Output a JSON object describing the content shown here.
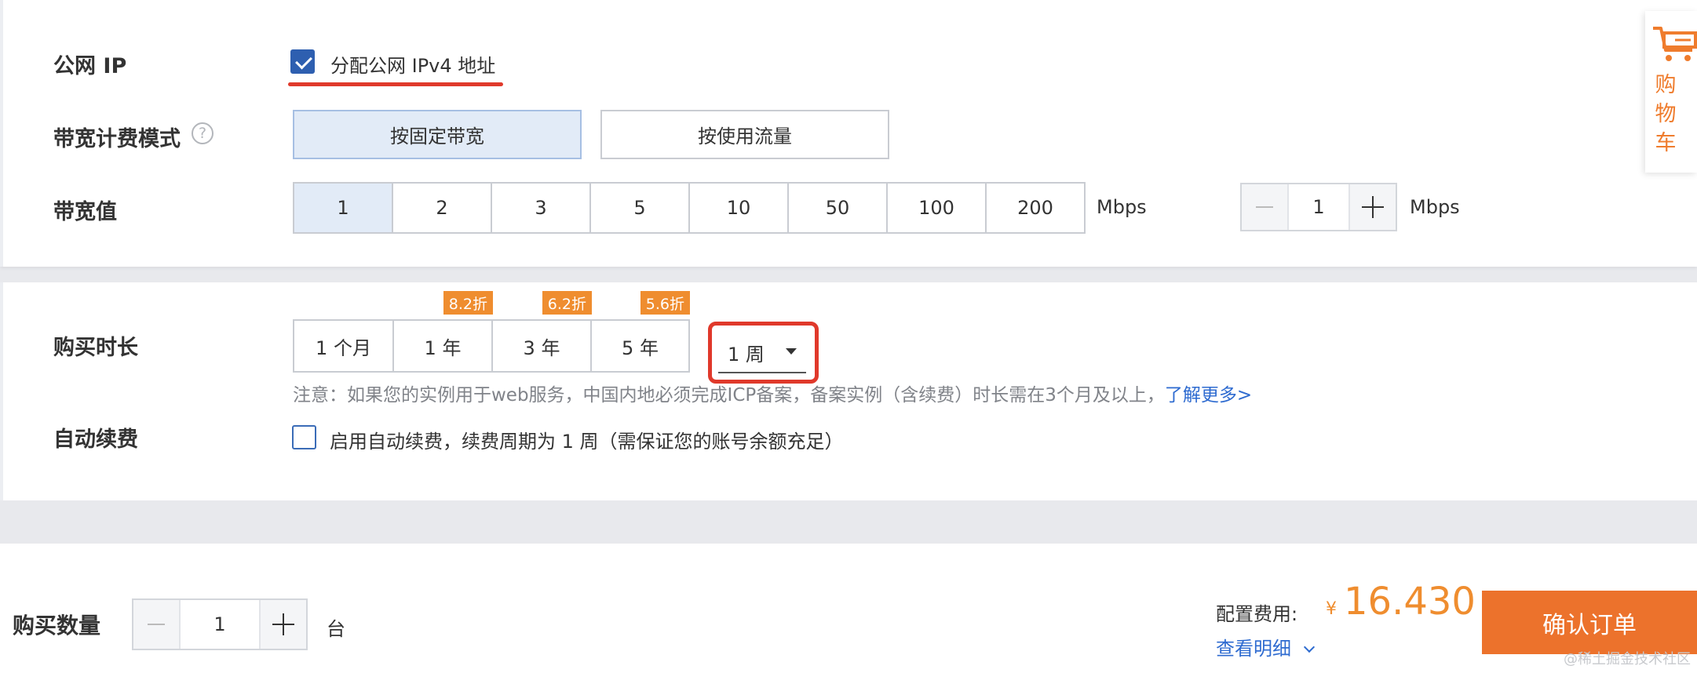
{
  "public_ip": {
    "label": "公网 IP",
    "checkbox_label": "分配公网 IPv4 地址",
    "checked": true
  },
  "billing_mode": {
    "label": "带宽计费模式",
    "help_icon": "question-circle-icon",
    "options": [
      "按固定带宽",
      "按使用流量"
    ],
    "selected": "按固定带宽"
  },
  "bandwidth": {
    "label": "带宽值",
    "options": [
      "1",
      "2",
      "3",
      "5",
      "10",
      "50",
      "100",
      "200"
    ],
    "selected": "1",
    "unit": "Mbps",
    "stepper_value": "1",
    "stepper_unit": "Mbps"
  },
  "duration": {
    "label": "购买时长",
    "options": [
      {
        "label": "1 个月",
        "discount": ""
      },
      {
        "label": "1 年",
        "discount": "8.2折"
      },
      {
        "label": "3 年",
        "discount": "6.2折"
      },
      {
        "label": "5 年",
        "discount": "5.6折"
      }
    ],
    "dropdown_value": "1 周",
    "notice_text": "注意：如果您的实例用于web服务，中国内地必须完成ICP备案，备案实例（含续费）时长需在3个月及以上，",
    "notice_link": "了解更多>"
  },
  "auto_renew": {
    "label": "自动续费",
    "checkbox_label": "启用自动续费，续费周期为 1 周（需保证您的账号余额充足）",
    "checked": false
  },
  "footer": {
    "quantity_label": "购买数量",
    "quantity_value": "1",
    "quantity_unit": "台",
    "price_label": "配置费用:",
    "currency": "¥",
    "price": "16.430",
    "detail_link": "查看明细",
    "confirm_button": "确认订单"
  },
  "cart": {
    "label": "购\n物\n车",
    "icon": "cart-icon"
  },
  "watermark": "@稀土掘金技术社区",
  "colors": {
    "accent_orange": "#ec722c",
    "price_orange": "#ef8d2f",
    "link_blue": "#2e6bd0",
    "annotation_red": "#e0392b"
  }
}
